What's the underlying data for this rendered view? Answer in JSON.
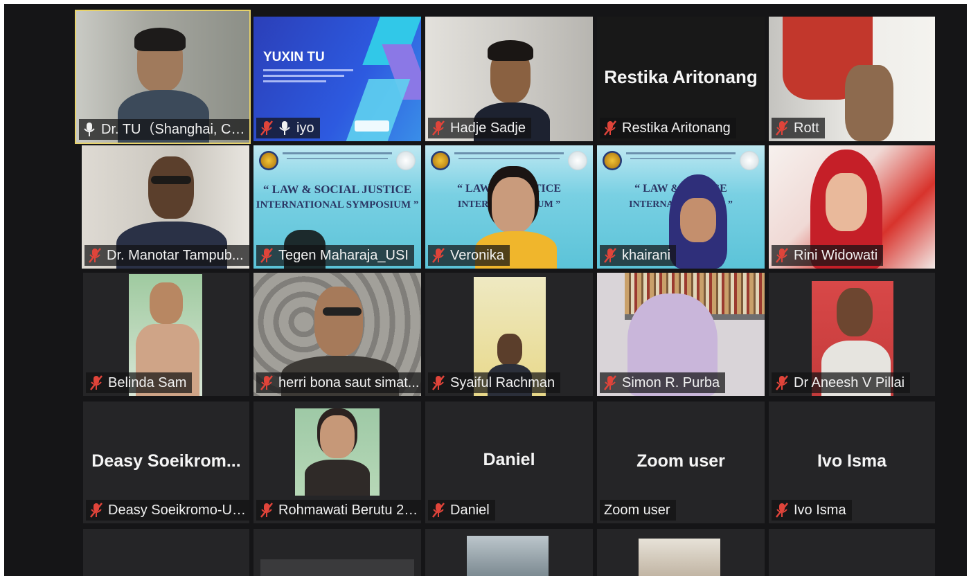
{
  "participants": {
    "tu": "Dr. TU（Shanghai, Ch...",
    "iyo": "iyo",
    "hadje": "Hadje Sadje",
    "restika": "Restika Aritonang",
    "rott": "Rott",
    "manotar": "Dr. Manotar Tampub...",
    "tegen": "Tegen Maharaja_USI",
    "veronika": "Veronika",
    "khairani": "khairani",
    "rini": "Rini Widowati",
    "belinda": "Belinda Sam",
    "herri": "herri bona saut simat...",
    "syaiful": "Syaiful Rachman",
    "simon": "Simon R. Purba",
    "aneesh": "Dr Aneesh V Pillai",
    "deasy": "Deasy Soeikromo-Un...",
    "rohmawati": "Rohmawati Berutu 21...",
    "daniel": "Daniel",
    "zoom": "Zoom user",
    "ivo": "Ivo Isma"
  },
  "center_names": {
    "restika": "Restika Aritonang",
    "deasy": "Deasy  Soeikrom...",
    "daniel": "Daniel",
    "zoom": "Zoom user",
    "ivo": "Ivo Isma"
  },
  "slide": {
    "title": "YUXIN TU"
  },
  "banner": {
    "line1": "“ LAW & SOCIAL JUSTICE",
    "line2": "INTERNATIONAL SYMPOSIUM ”",
    "v_line1": "“ LAW & S   JUSTICE",
    "v_line2": "INTERNATI   POSIUM ”",
    "k_line1": "“ LAW & SO   TICE",
    "k_line2": "INTERNATION   SIUM ”"
  },
  "colors": {
    "active_speaker": "#e8d36a",
    "muted_icon": "#e0443a",
    "banner": "#79d0e3",
    "slide": "#2d4fd6"
  }
}
